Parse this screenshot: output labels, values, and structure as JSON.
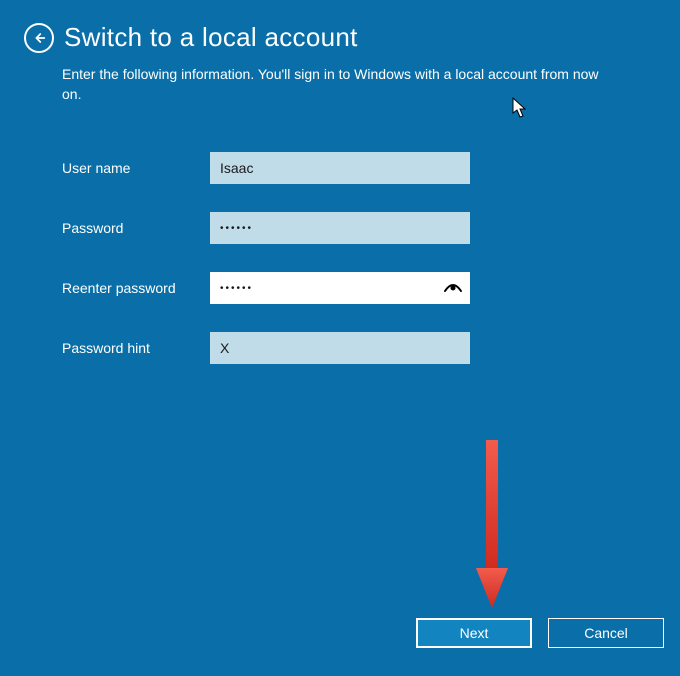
{
  "header": {
    "title": "Switch to a local account",
    "subtitle": "Enter the following information. You'll sign in to Windows with a local account from now on."
  },
  "form": {
    "username": {
      "label": "User name",
      "value": "Isaac"
    },
    "password": {
      "label": "Password",
      "value": "••••••"
    },
    "reenter": {
      "label": "Reenter password",
      "value": "••••••"
    },
    "hint": {
      "label": "Password hint",
      "value": "X"
    }
  },
  "footer": {
    "next": "Next",
    "cancel": "Cancel"
  },
  "annotation": {
    "arrow_color": "#e03a2f"
  }
}
